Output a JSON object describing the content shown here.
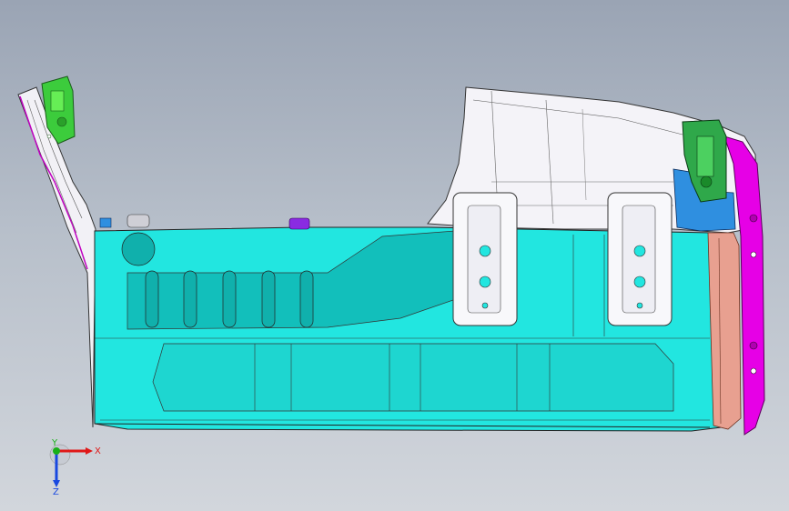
{
  "viewport": {
    "background_top": "#9aa4b4",
    "background_bottom": "#d2d6dc"
  },
  "model": {
    "part_colors": {
      "floor_panel": "#22e6e0",
      "floor_panel_shade": "#12b8b4",
      "wheelhouse_shell": "#f4f3f8",
      "rear_end_trim": "#e600e6",
      "green_bracket": "#33cc33",
      "seal_strip": "#e8a090",
      "blue_bracket": "#2f8fe0",
      "tie_down_bracket": "#f8f8fb"
    }
  },
  "triad": {
    "x_label": "X",
    "y_label": "Y",
    "z_label": "Z",
    "x_color": "#e01818",
    "y_color": "#18b018",
    "z_color": "#1848e0"
  }
}
